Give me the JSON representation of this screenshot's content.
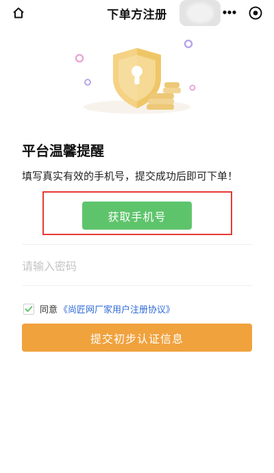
{
  "header": {
    "title": "下单方注册",
    "home_icon": "home-icon",
    "more_icon": "more-dots-icon",
    "close_icon": "target-close-icon"
  },
  "illustration": {
    "icon": "shield-lock-coins-illustration",
    "accent_color": "#f3c866"
  },
  "notice": {
    "title": "平台温馨提醒",
    "text": "填写真实有效的手机号，提交成功后即可下单！"
  },
  "get_phone_button": {
    "label": "获取手机号",
    "color": "#5ec46c"
  },
  "password": {
    "value": "",
    "placeholder": "请输入密码"
  },
  "agreement": {
    "checked": true,
    "prefix": "同意",
    "link_text": "《尚匠网厂家用户注册协议》"
  },
  "submit_button": {
    "label": "提交初步认证信息",
    "color": "#f0a23d"
  },
  "colors": {
    "highlight_border": "#e53935",
    "link": "#2f6ad8",
    "check": "#5ec46c"
  }
}
